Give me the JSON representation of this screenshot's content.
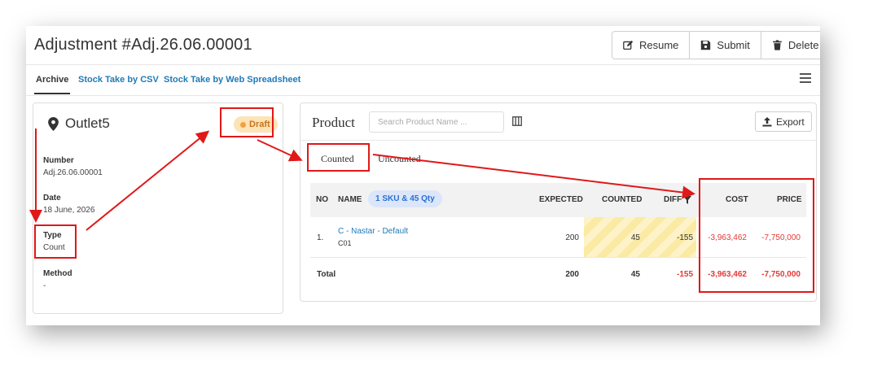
{
  "header": {
    "title": "Adjustment #Adj.26.06.00001",
    "buttons": {
      "resume": "Resume",
      "submit": "Submit",
      "delete": "Delete"
    }
  },
  "tabs": [
    "Archive",
    "Stock Take by CSV",
    "Stock Take by Web Spreadsheet"
  ],
  "info": {
    "outlet": "Outlet5",
    "status": "Draft",
    "fields": [
      {
        "label": "Number",
        "value": "Adj.26.06.00001"
      },
      {
        "label": "Date",
        "value": "18 June, 2026"
      },
      {
        "label": "Type",
        "value": "Count"
      },
      {
        "label": "Method",
        "value": "-"
      }
    ]
  },
  "product": {
    "title": "Product",
    "search_placeholder": "Search Product Name ...",
    "export_label": "Export",
    "tabs": [
      "Counted",
      "Uncounted"
    ],
    "columns": {
      "no": "NO",
      "name": "NAME",
      "expected": "EXPECTED",
      "counted": "COUNTED",
      "diff": "DIFF",
      "cost": "COST",
      "price": "PRICE"
    },
    "summary_pill": "1 SKU & 45 Qty",
    "rows": [
      {
        "no": "1.",
        "name": "C - Nastar - Default",
        "code": "C01",
        "expected": "200",
        "counted": "45",
        "diff": "-155",
        "cost": "-3,963,462",
        "price": "-7,750,000"
      }
    ],
    "total": {
      "label": "Total",
      "expected": "200",
      "counted": "45",
      "diff": "-155",
      "cost": "-3,963,462",
      "price": "-7,750,000"
    }
  },
  "colors": {
    "accent": "#1f7ab8",
    "annotation": "#e01818",
    "negative": "#e53935",
    "badge_bg": "#fde3b6"
  }
}
